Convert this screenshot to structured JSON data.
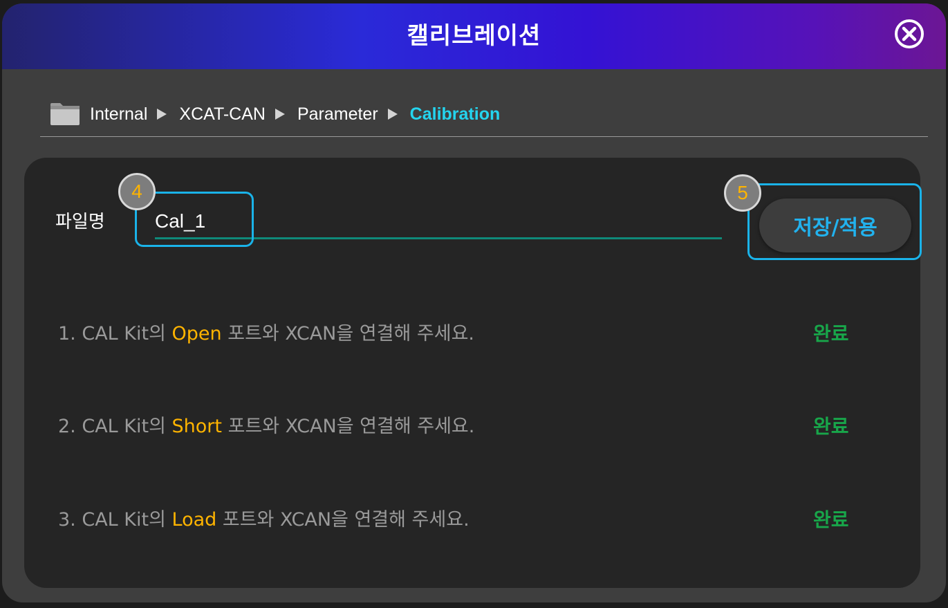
{
  "dialog": {
    "title": "캘리브레이션",
    "close_icon": "close-circle-icon"
  },
  "breadcrumb": {
    "folder_icon": "folder-icon",
    "items": [
      "Internal",
      "XCAT-CAN",
      "Parameter",
      "Calibration"
    ]
  },
  "file": {
    "label": "파일명",
    "value": "Cal_1"
  },
  "save_button": {
    "label": "저장/적용"
  },
  "badges": [
    "4",
    "5"
  ],
  "steps": [
    {
      "prefix": "1. CAL Kit의 ",
      "port": "Open",
      "suffix": " 포트와 XCAN을 연결해 주세요.",
      "status": "완료"
    },
    {
      "prefix": "2. CAL Kit의 ",
      "port": "Short",
      "suffix": " 포트와 XCAN을 연결해 주세요.",
      "status": "완료"
    },
    {
      "prefix": "3. CAL Kit의 ",
      "port": "Load",
      "suffix": " 포트와 XCAN을 연결해 주세요.",
      "status": "완료"
    }
  ],
  "colors": {
    "breadcrumb_current": "#24d4ee",
    "port_highlight": "#ffb400",
    "status_done": "#18a64a",
    "highlight_box": "#1ab3e9",
    "input_underline": "#0f8a7a"
  }
}
